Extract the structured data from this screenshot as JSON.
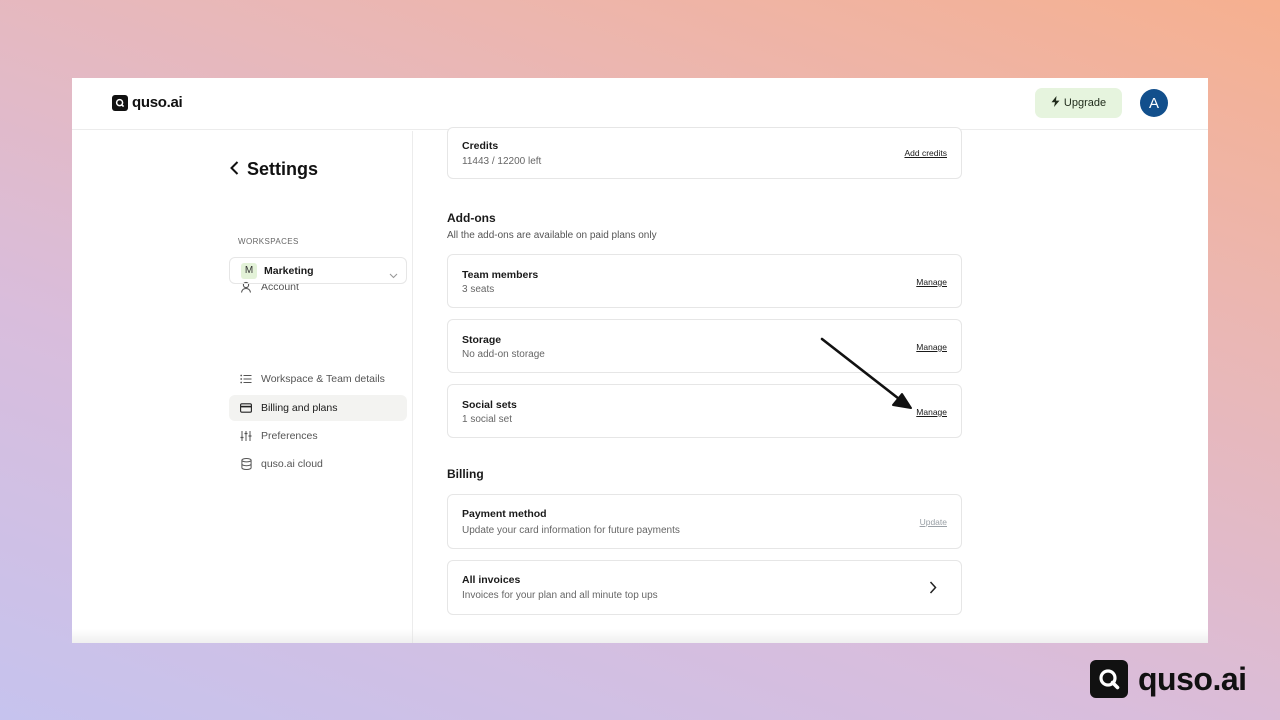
{
  "app": {
    "logo_text": "quso.ai"
  },
  "topbar": {
    "upgrade_label": "Upgrade",
    "avatar_initial": "A"
  },
  "sidebar": {
    "title": "Settings",
    "account_label": "Account",
    "workspaces_label": "WORKSPACES",
    "workspace": {
      "badge": "M",
      "name": "Marketing"
    },
    "items": [
      {
        "label": "Workspace & Team details",
        "icon": "list-icon",
        "active": false
      },
      {
        "label": "Billing and plans",
        "icon": "credit-card-icon",
        "active": true
      },
      {
        "label": "Preferences",
        "icon": "sliders-icon",
        "active": false
      },
      {
        "label": "quso.ai cloud",
        "icon": "database-icon",
        "active": false
      }
    ]
  },
  "credits": {
    "title": "Credits",
    "value": "11443 / 12200 left",
    "link": "Add credits"
  },
  "addons": {
    "title": "Add-ons",
    "subtitle": "All the add-ons are available on paid plans only",
    "items": [
      {
        "title": "Team members",
        "value": "3 seats",
        "link": "Manage"
      },
      {
        "title": "Storage",
        "value": "No add-on storage",
        "link": "Manage"
      },
      {
        "title": "Social sets",
        "value": "1 social set",
        "link": "Manage"
      }
    ]
  },
  "billing": {
    "title": "Billing",
    "payment": {
      "title": "Payment method",
      "subtitle": "Update your card information for future payments",
      "link": "Update"
    },
    "invoices": {
      "title": "All invoices",
      "subtitle": "Invoices for your plan and all minute top ups"
    }
  },
  "watermark": {
    "text": "quso.ai"
  },
  "colors": {
    "avatar": "#124f8c",
    "upgrade_bg": "#e6f4de",
    "active_nav": "#f3f3f1"
  }
}
